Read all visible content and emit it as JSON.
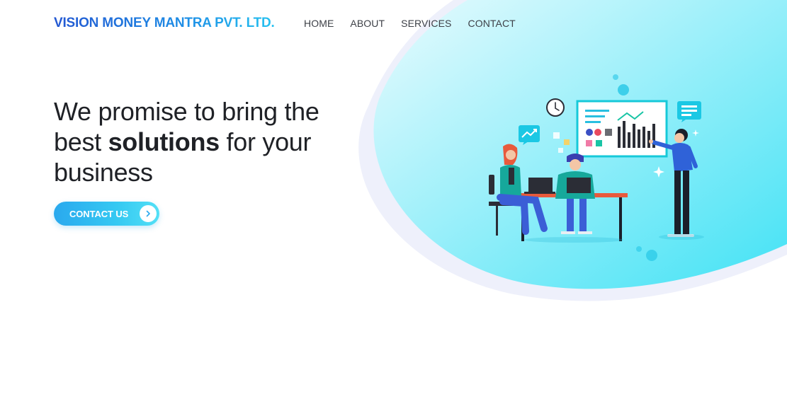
{
  "header": {
    "brand": "VISION MONEY MANTRA PVT. LTD.",
    "nav": [
      {
        "label": "HOME"
      },
      {
        "label": "ABOUT"
      },
      {
        "label": "SERVICES"
      },
      {
        "label": "CONTACT"
      }
    ]
  },
  "hero": {
    "title_part1": "We promise to bring the best ",
    "title_emphasis": "solutions",
    "title_part2": " for your business",
    "cta_label": "CONTACT US",
    "cta_icon": "chevron-right-icon"
  },
  "illustration": {
    "subject": "team-meeting-illustration"
  },
  "colors": {
    "brand_start": "#2357d2",
    "brand_end": "#27c2f0",
    "cta": "#2aa9ee",
    "blob": "#5ae6f7",
    "text": "#1f2126"
  }
}
